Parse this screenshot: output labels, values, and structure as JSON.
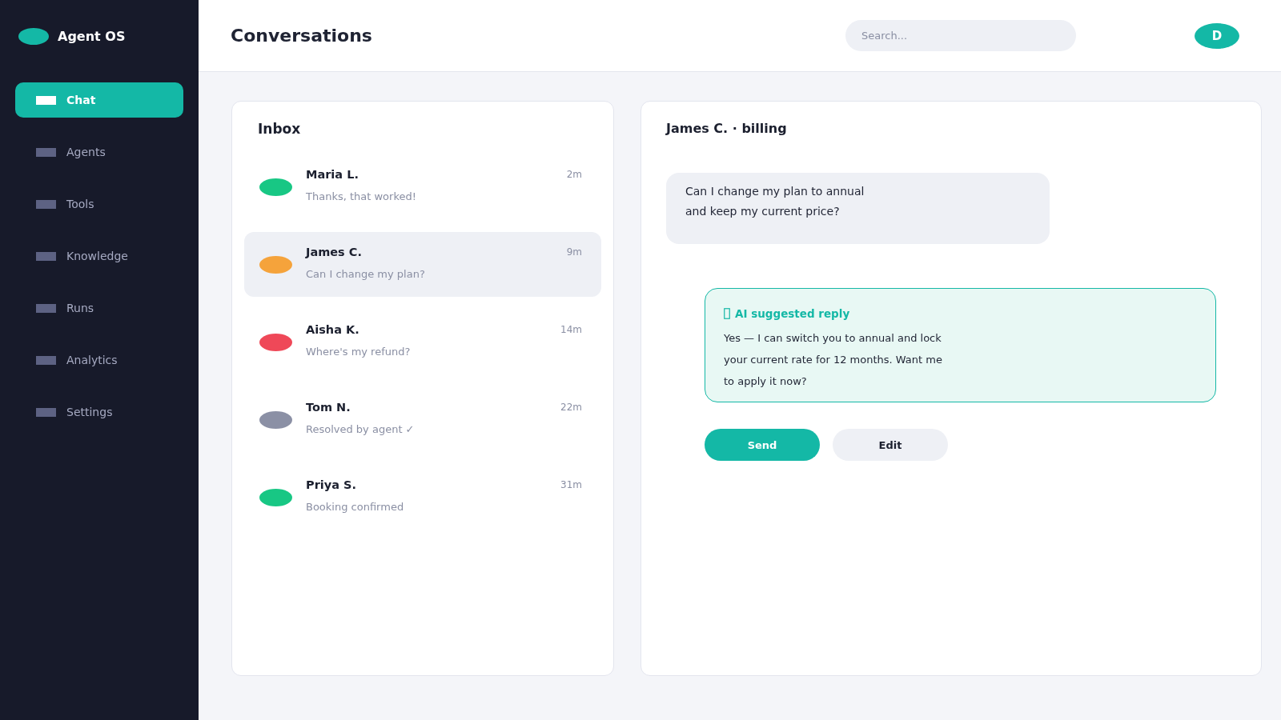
{
  "sidebar": {
    "brand": "Agent OS",
    "items": [
      {
        "label": "Chat",
        "selected": true
      },
      {
        "label": "Agents",
        "selected": false
      },
      {
        "label": "Tools",
        "selected": false
      },
      {
        "label": "Knowledge",
        "selected": false
      },
      {
        "label": "Runs",
        "selected": false
      },
      {
        "label": "Analytics",
        "selected": false
      },
      {
        "label": "Settings",
        "selected": false
      }
    ]
  },
  "header": {
    "title": "Conversations",
    "search": {
      "placeholder": "Search..."
    },
    "avatar": "D"
  },
  "inbox": {
    "title": "Inbox",
    "conversations": [
      {
        "name": "Maria L.",
        "time": "2m",
        "preview": "Thanks, that worked!",
        "color": "#18c784",
        "selected": false
      },
      {
        "name": "James C.",
        "time": "9m",
        "preview": "Can I change my plan?",
        "color": "#f5a33b",
        "selected": true
      },
      {
        "name": "Aisha K.",
        "time": "14m",
        "preview": "Where's my refund?",
        "color": "#ef4858",
        "selected": false
      },
      {
        "name": "Tom N.",
        "time": "22m",
        "preview": "Resolved by agent ✓",
        "color": "#8b90a5",
        "selected": false
      },
      {
        "name": "Priya S.",
        "time": "31m",
        "preview": "Booking confirmed",
        "color": "#18c784",
        "selected": false
      }
    ]
  },
  "thread": {
    "title": "James C. · billing",
    "messages": [
      {
        "lines": [
          "Can I change my plan to annual",
          "and keep my current price?"
        ]
      }
    ],
    "suggestion": {
      "label": "AI suggested reply",
      "lines": [
        "Yes — I can switch you to annual and lock",
        "your current rate for 12 months. Want me",
        "to apply it now?"
      ]
    },
    "actions": [
      {
        "label": "Send",
        "kind": "primary"
      },
      {
        "label": "Edit",
        "kind": "secondary"
      }
    ]
  }
}
